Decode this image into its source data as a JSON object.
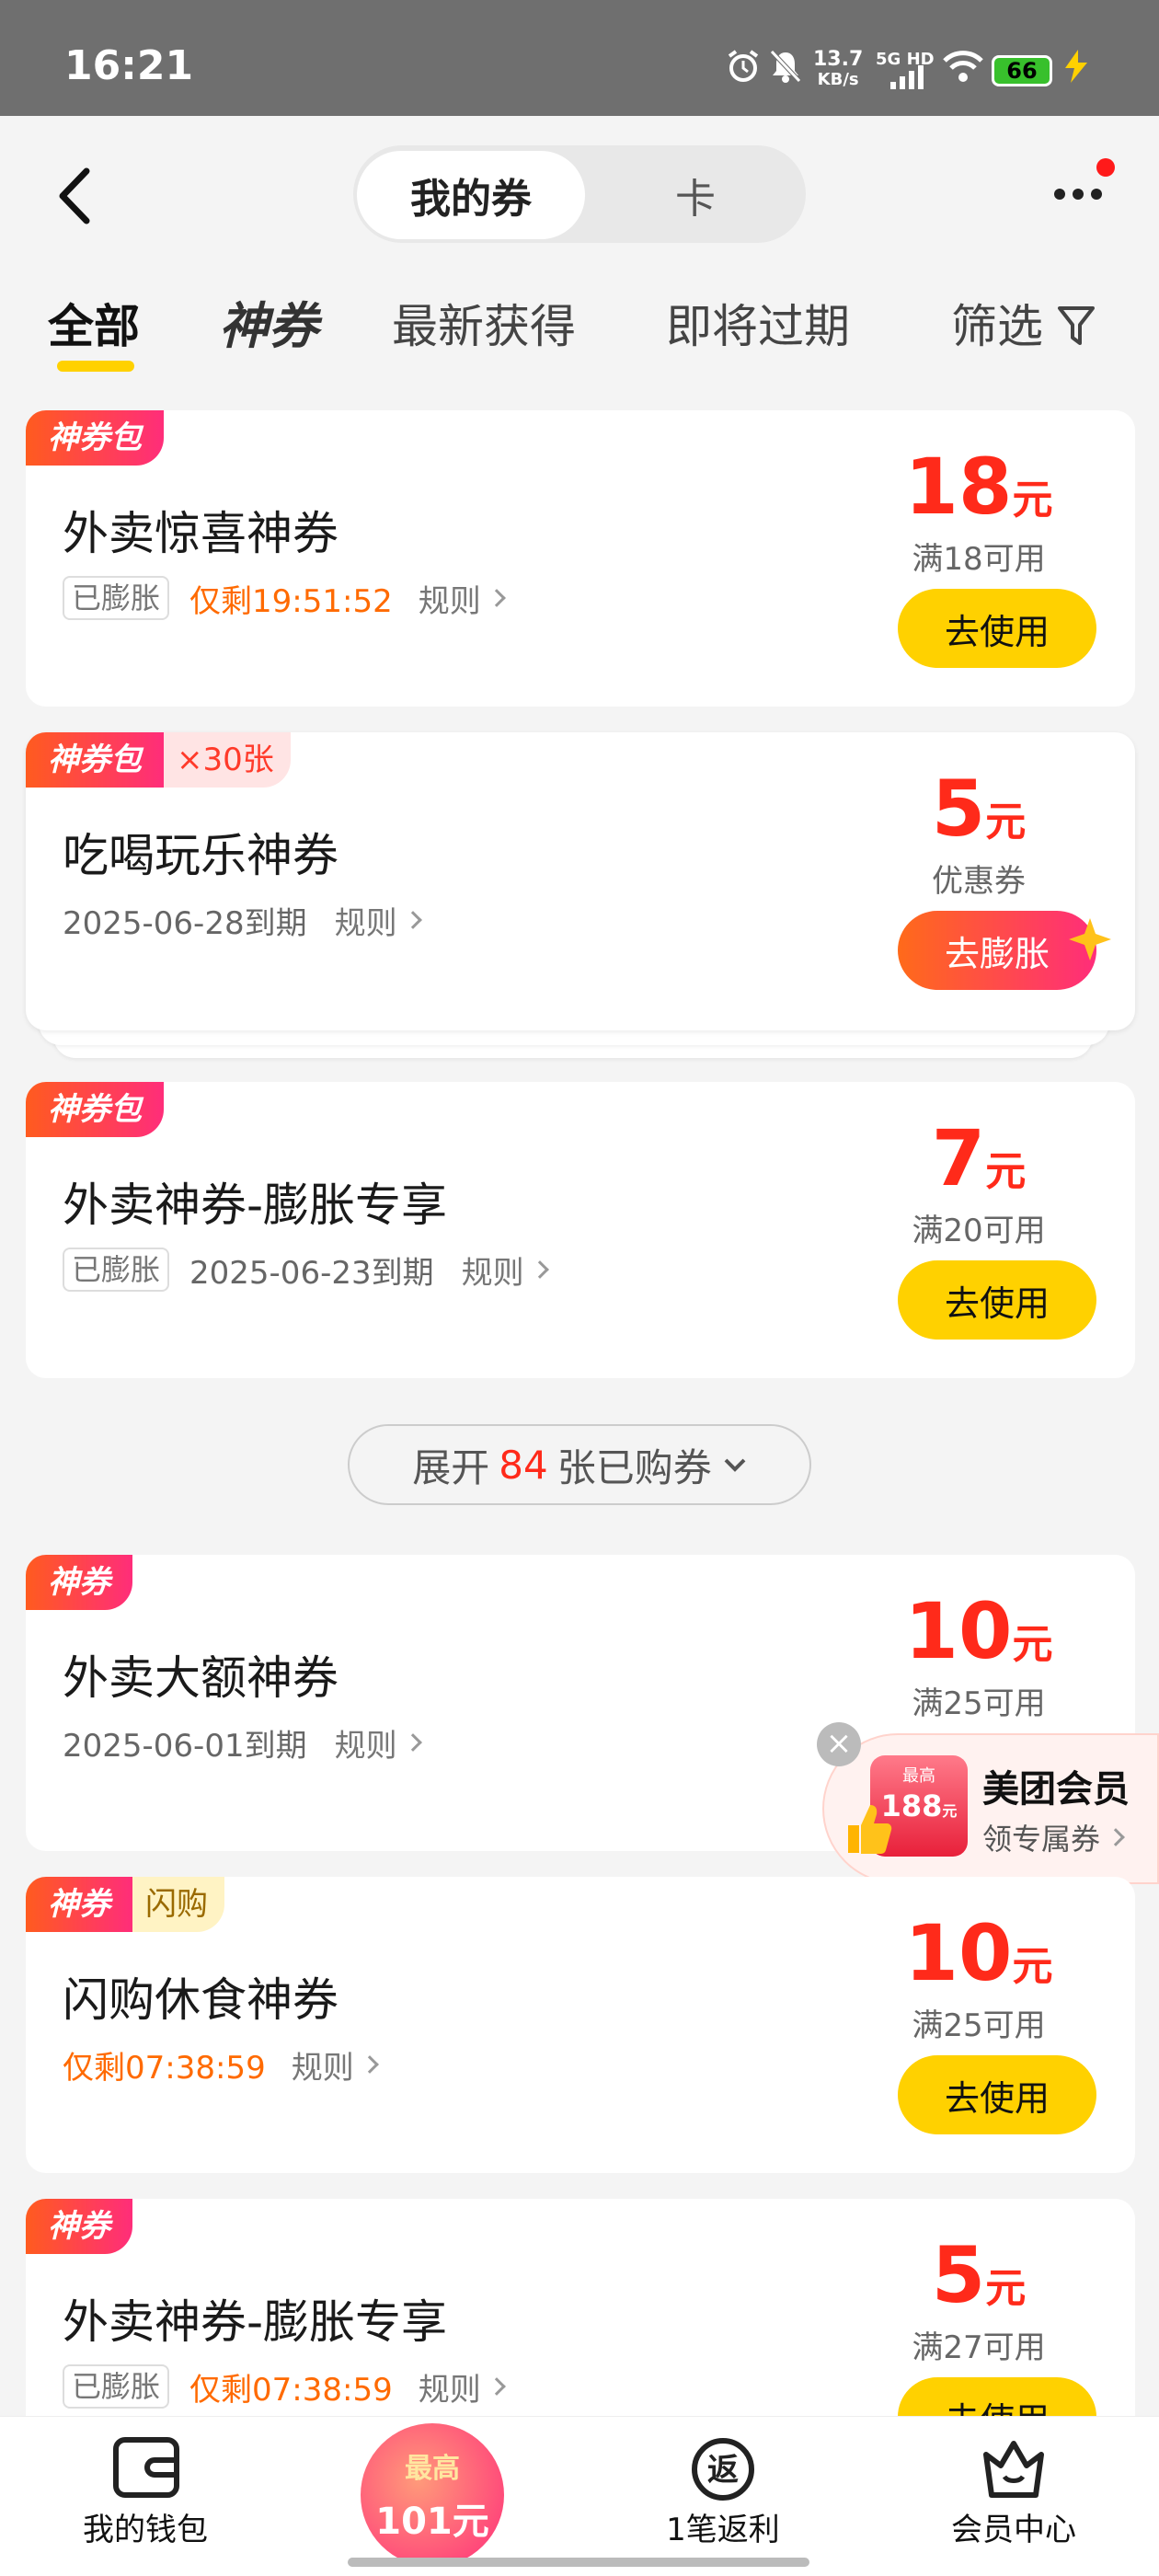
{
  "status_bar": {
    "time": "16:21",
    "net_speed_value": "13.7",
    "net_speed_unit": "KB/s",
    "network": "5G HD",
    "battery": "66"
  },
  "header": {
    "tab_coupons": "我的券",
    "tab_cards": "卡"
  },
  "filter_tabs": {
    "all": "全部",
    "shen": "神券",
    "newest": "最新获得",
    "expiring": "即将过期",
    "filter": "筛选"
  },
  "coupons": [
    {
      "tag": "神券包",
      "extra_tag": "",
      "title": "外卖惊喜神券",
      "badge": "已膨胀",
      "countdown": "仅剩19:51:52",
      "date": "",
      "rule": "规则",
      "amount": "18",
      "unit": "元",
      "condition": "满18可用",
      "action": "去使用"
    },
    {
      "tag": "神券包",
      "extra_tag": "×30张",
      "title": "吃喝玩乐神券",
      "badge": "",
      "countdown": "",
      "date": "2025-06-28到期",
      "rule": "规则",
      "amount": "5",
      "unit": "元",
      "condition": "优惠券",
      "action": "去膨胀"
    },
    {
      "tag": "神券包",
      "extra_tag": "",
      "title": "外卖神券-膨胀专享",
      "badge": "已膨胀",
      "countdown": "",
      "date": "2025-06-23到期",
      "rule": "规则",
      "amount": "7",
      "unit": "元",
      "condition": "满20可用",
      "action": "去使用"
    },
    {
      "tag": "神券",
      "extra_tag": "",
      "title": "外卖大额神券",
      "badge": "",
      "countdown": "",
      "date": "2025-06-01到期",
      "rule": "规则",
      "amount": "10",
      "unit": "元",
      "condition": "满25可用",
      "action": ""
    },
    {
      "tag": "神券",
      "extra_tag": "闪购",
      "title": "闪购休食神券",
      "badge": "",
      "countdown": "仅剩07:38:59",
      "date": "",
      "rule": "规则",
      "amount": "10",
      "unit": "元",
      "condition": "满25可用",
      "action": "去使用"
    },
    {
      "tag": "神券",
      "extra_tag": "",
      "title": "外卖神券-膨胀专享",
      "badge": "已膨胀",
      "countdown": "仅剩07:38:59",
      "date": "",
      "rule": "规则",
      "amount": "5",
      "unit": "元",
      "condition": "满27可用",
      "action": "去使用"
    }
  ],
  "expand": {
    "prefix": "展开",
    "count": "84",
    "suffix": "张已购券"
  },
  "member_float": {
    "box_top": "最高",
    "box_amount": "188",
    "box_unit": "元",
    "title": "美团会员",
    "subtitle": "领专属券"
  },
  "bottom_nav": {
    "wallet": "我的钱包",
    "center_top": "最高",
    "center_amount": "101元",
    "rebate": "1笔返利",
    "member": "会员中心"
  },
  "colors": {
    "accent_yellow": "#ffd100",
    "price_red": "#ff2a1a",
    "countdown_orange": "#ff6a00"
  }
}
